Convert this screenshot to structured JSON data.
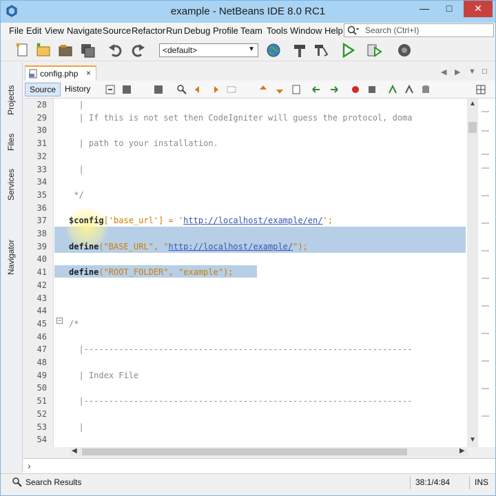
{
  "window": {
    "title": "example - NetBeans IDE 8.0 RC1",
    "minimize": "—",
    "maximize": "□",
    "close": "✕"
  },
  "menu": [
    "File",
    "Edit",
    "View",
    "Navigate",
    "Source",
    "Refactor",
    "Run",
    "Debug",
    "Profile",
    "Team",
    "Tools",
    "Window",
    "Help"
  ],
  "search": {
    "placeholder": "Search (Ctrl+I)"
  },
  "toolbar": {
    "config": "<default>"
  },
  "sidebar": [
    "Projects",
    "Files",
    "Services",
    "Navigator"
  ],
  "tab": {
    "name": "config.php",
    "close": "×"
  },
  "editor_modes": {
    "source": "Source",
    "history": "History"
  },
  "code_lines": [
    {
      "n": "28",
      "t": "  |"
    },
    {
      "n": "29",
      "t": "  | If this is not set then CodeIgniter will guess the protocol, doma"
    },
    {
      "n": "30",
      "t": ""
    },
    {
      "n": "31",
      "t": "  | path to your installation."
    },
    {
      "n": "32",
      "t": ""
    },
    {
      "n": "33",
      "t": "  |"
    },
    {
      "n": "34",
      "t": ""
    },
    {
      "n": "35",
      "t": " */"
    },
    {
      "n": "36",
      "t": ""
    },
    {
      "n": "37",
      "t": ""
    },
    {
      "n": "38",
      "t": ""
    },
    {
      "n": "39",
      "t": ""
    },
    {
      "n": "40",
      "t": ""
    },
    {
      "n": "41",
      "t": ""
    },
    {
      "n": "42",
      "t": ""
    },
    {
      "n": "43",
      "t": ""
    },
    {
      "n": "44",
      "t": ""
    },
    {
      "n": "45",
      "t": "/*"
    },
    {
      "n": "46",
      "t": ""
    },
    {
      "n": "47",
      "t": "  |------------------------------------------------------------------"
    },
    {
      "n": "48",
      "t": ""
    },
    {
      "n": "49",
      "t": "  | Index File"
    },
    {
      "n": "50",
      "t": ""
    },
    {
      "n": "51",
      "t": "  |------------------------------------------------------------------"
    },
    {
      "n": "52",
      "t": ""
    },
    {
      "n": "53",
      "t": "  |"
    },
    {
      "n": "54",
      "t": ""
    }
  ],
  "code37": {
    "var": "$config",
    "rest": "['base_url'] = '",
    "url": "http://localhost/example/en/",
    "end": "';"
  },
  "code39": {
    "kw": "define",
    "open": "(\"BASE_URL\", \"",
    "url": "http://localhost/example/",
    "end": "\");"
  },
  "code41": {
    "kw": "define",
    "rest": "(\"ROOT_FOLDER\", \"example\");"
  },
  "status": {
    "search_results": "Search Results",
    "position": "38:1/4:84",
    "mode": "INS"
  }
}
